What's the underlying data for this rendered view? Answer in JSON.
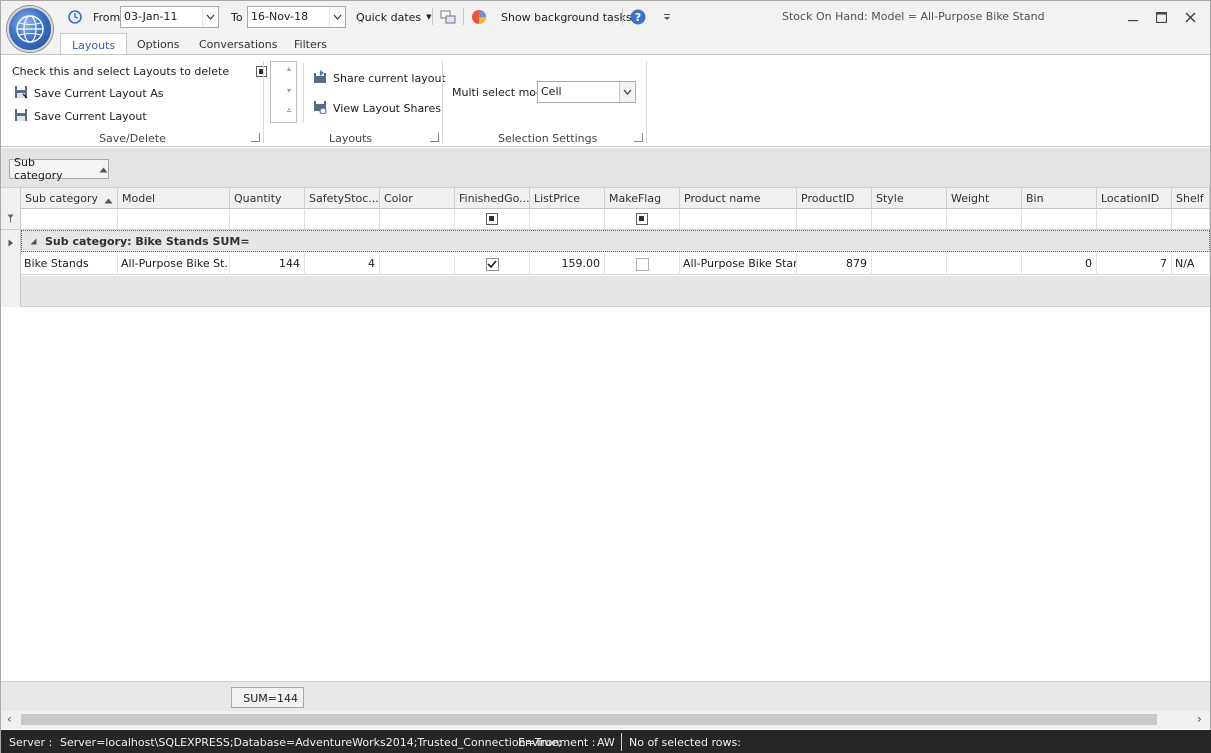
{
  "titlebar": {
    "from_label": "From",
    "from_date": "03-Jan-11",
    "to_label": "To",
    "to_date": "16-Nov-18",
    "quick_dates": "Quick dates",
    "show_bg_tasks": "Show background tasks",
    "window_title": "Stock On Hand: Model = All-Purpose Bike Stand"
  },
  "ribbon_tabs": [
    "Layouts",
    "Options",
    "Conversations",
    "Filters"
  ],
  "ribbon": {
    "check_delete_label": "Check this and select Layouts to delete",
    "save_as_label": "Save Current Layout As",
    "save_label": "Save Current Layout",
    "save_delete_caption": "Save/Delete",
    "share_label": "Share current layout",
    "view_shares_label": "View Layout Shares",
    "layouts_caption": "Layouts",
    "multi_select_label": "Multi select mode",
    "multi_select_value": "Cell",
    "selection_caption": "Selection Settings"
  },
  "group_panel": {
    "chip_label": "Sub category"
  },
  "grid": {
    "columns": [
      "Sub category",
      "Model",
      "Quantity",
      "SafetyStoc...",
      "Color",
      "FinishedGo...",
      "ListPrice",
      "MakeFlag",
      "Product name",
      "ProductID",
      "Style",
      "Weight",
      "Bin",
      "LocationID",
      "Shelf"
    ],
    "group_row_label": "Sub category: Bike Stands SUM=",
    "row": {
      "sub_category": "Bike Stands",
      "model": "All-Purpose Bike St...",
      "quantity": "144",
      "safety_stock": "4",
      "color": "",
      "finished_goods": true,
      "list_price": "159.00",
      "make_flag": false,
      "product_name": "All-Purpose Bike Stand",
      "product_id": "879",
      "style": "",
      "weight": "",
      "bin": "0",
      "location_id": "7",
      "shelf": "N/A"
    }
  },
  "footer": {
    "sum_text": "SUM=144"
  },
  "statusbar": {
    "server_label": "Server :",
    "server_value": "Server=localhost\\SQLEXPRESS;Database=AdventureWorks2014;Trusted_Connection=True;",
    "environment_label": "Environment :",
    "environment_value": "AW",
    "selected_rows_label": "No of selected rows:"
  },
  "colors": {
    "accent": "#2c62b2",
    "statusbar_bg": "#262626",
    "group_row_bg": "#e6e6e6"
  }
}
